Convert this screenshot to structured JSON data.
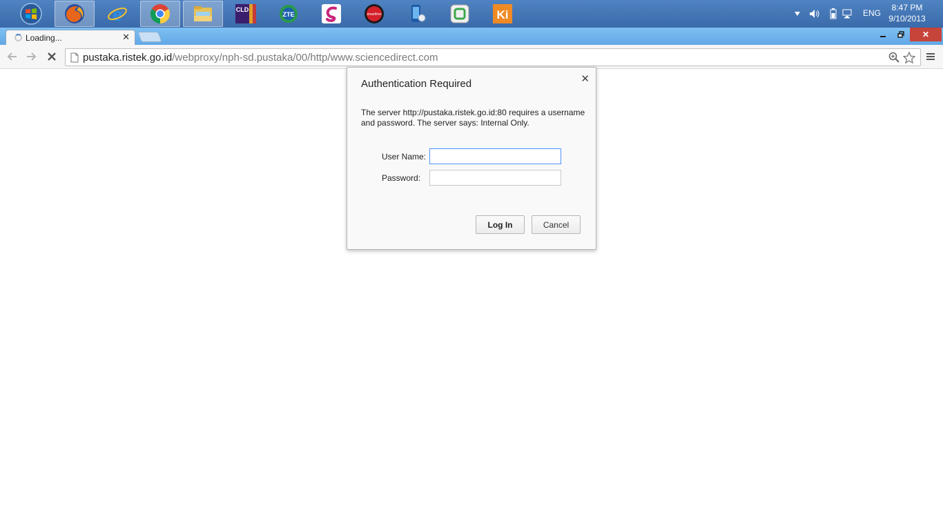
{
  "taskbar": {
    "icons": [
      {
        "name": "windows-start-icon"
      },
      {
        "name": "firefox-icon",
        "active": true
      },
      {
        "name": "internet-explorer-icon"
      },
      {
        "name": "chrome-icon",
        "active": true
      },
      {
        "name": "file-explorer-icon",
        "active": true
      },
      {
        "name": "cld-app-icon",
        "label": "CLD"
      },
      {
        "name": "zte-app-icon",
        "label": "ZTE"
      },
      {
        "name": "pink-app-icon"
      },
      {
        "name": "smartfren-app-icon",
        "label": "smartfren"
      },
      {
        "name": "phone-app-icon"
      },
      {
        "name": "green-app-icon"
      },
      {
        "name": "ki-app-icon",
        "label": "Ki"
      }
    ],
    "language": "ENG",
    "time": "8:47 PM",
    "date": "9/10/2013"
  },
  "browser": {
    "tab_title": "Loading...",
    "url_host": "pustaka.ristek.go.id",
    "url_path": "/webproxy/nph-sd.pustaka/00/http/www.sciencedirect.com"
  },
  "dialog": {
    "title": "Authentication Required",
    "message": "The server http://pustaka.ristek.go.id:80 requires a username and password. The server says: Internal Only.",
    "username_label": "User Name:",
    "password_label": "Password:",
    "username_value": "",
    "password_value": "",
    "login_label": "Log In",
    "cancel_label": "Cancel"
  },
  "colors": {
    "taskbar": "#3d6fb0",
    "tabstrip": "#6fb4ec",
    "close_red": "#c7443a",
    "focus_blue": "#4d90fe"
  }
}
